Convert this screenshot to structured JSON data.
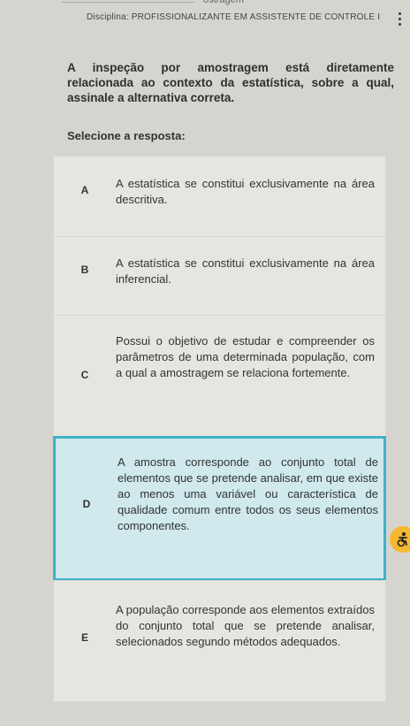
{
  "header": {
    "top_fragment": "ostragem",
    "discipline": "Disciplina: PROFISSIONALIZANTE EM ASSISTENTE DE CONTROLE I"
  },
  "question": {
    "text": "A inspeção por amostragem está diretamente relacionada ao contexto da estatística, sobre a qual, assinale a alternativa correta."
  },
  "answer_prompt": "Selecione a resposta:",
  "options": [
    {
      "letter": "A",
      "text": "A estatística se constitui exclusivamente na área descritiva."
    },
    {
      "letter": "B",
      "text": "A estatística se constitui exclusivamente na área inferencial."
    },
    {
      "letter": "C",
      "text": "Possui o objetivo de estudar e compreender os parâmetros de uma determinada população, com a qual a amostragem se relaciona fortemente."
    },
    {
      "letter": "D",
      "text": "A amostra corresponde ao conjunto total de elementos que se pretende analisar, em que existe ao menos uma variável ou característica de qualidade comum entre todos os seus elementos componentes."
    },
    {
      "letter": "E",
      "text": "A população corresponde aos elementos extraídos do conjunto total que se pretende analisar, selecionados segundo métodos adequados."
    }
  ],
  "selected_option": "D",
  "colors": {
    "selected_border": "#3fb2c7",
    "selected_bg": "#cfe9ec",
    "option_bg": "#e7e5e0",
    "fab": "#f6b830"
  },
  "icons": {
    "more": "more-vertical-icon",
    "accessibility": "accessibility-icon"
  }
}
